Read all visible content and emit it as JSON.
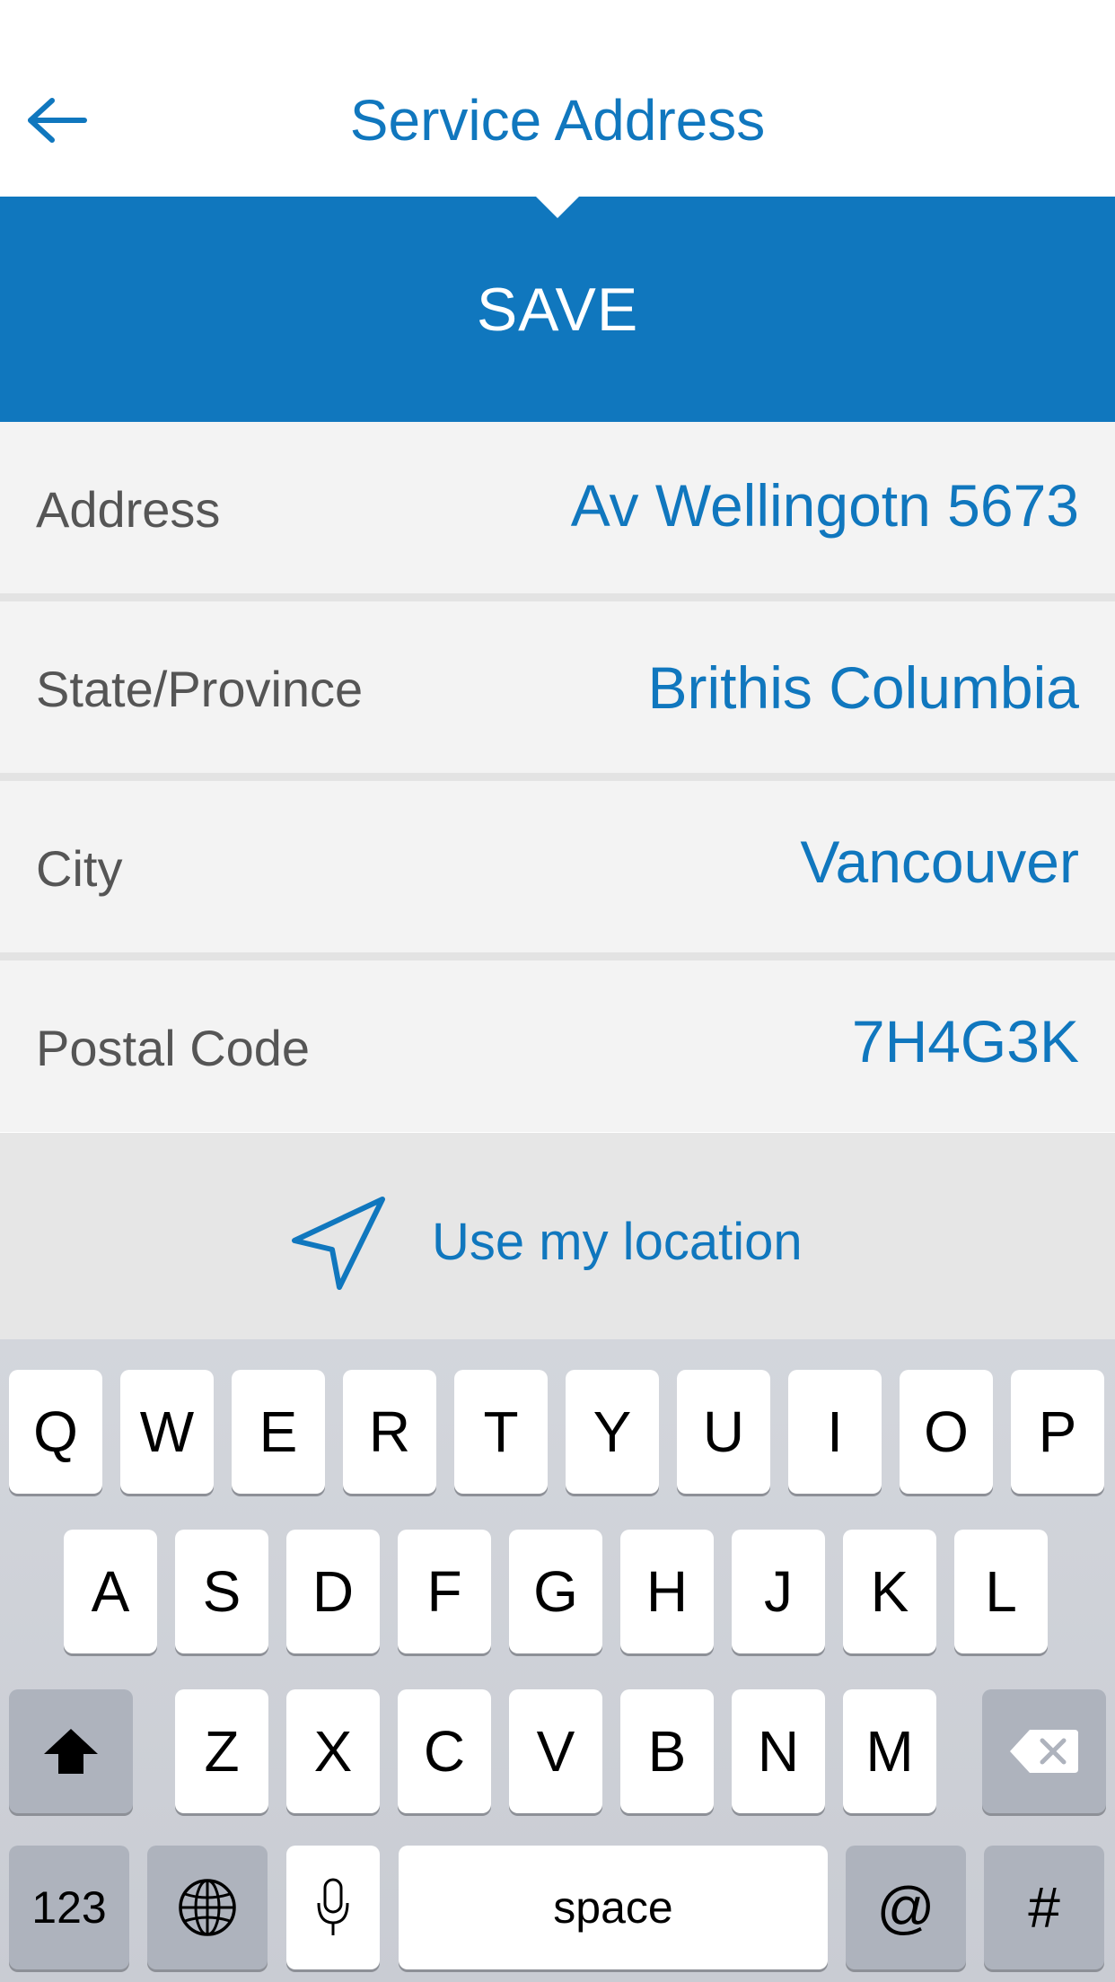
{
  "header": {
    "back_icon": "arrow-left-icon",
    "title": "Service Address"
  },
  "save_label": "SAVE",
  "form": {
    "fields": [
      {
        "label": "Address",
        "value": "Av Wellingotn 5673"
      },
      {
        "label": "State/Province",
        "value": "Brithis Columbia"
      },
      {
        "label": "City",
        "value": "Vancouver"
      },
      {
        "label": "Postal Code",
        "value": "7H4G3K"
      }
    ]
  },
  "location": {
    "icon": "location-arrow-icon",
    "label": "Use my location"
  },
  "keyboard": {
    "row1": [
      "Q",
      "W",
      "E",
      "R",
      "T",
      "Y",
      "U",
      "I",
      "O",
      "P"
    ],
    "row2": [
      "A",
      "S",
      "D",
      "F",
      "G",
      "H",
      "J",
      "K",
      "L"
    ],
    "row3": [
      "Z",
      "X",
      "C",
      "V",
      "B",
      "N",
      "M"
    ],
    "shift_icon": "shift-icon",
    "backspace_icon": "backspace-icon",
    "numbers_label": "123",
    "globe_icon": "globe-icon",
    "mic_icon": "microphone-icon",
    "space_label": "space",
    "at_label": "@",
    "hash_label": "#"
  },
  "colors": {
    "accent": "#1077be",
    "field_background": "#f3f3f3",
    "location_background": "#e6e6e6",
    "keyboard_background": "#d1d4da"
  }
}
